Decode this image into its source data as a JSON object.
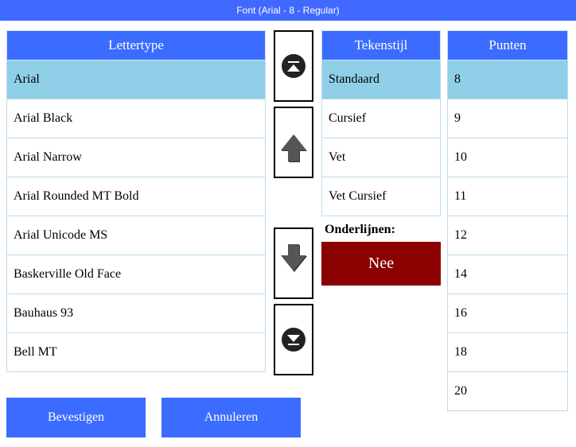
{
  "title": "Font (Arial - 8 - Regular)",
  "headers": {
    "font": "Lettertype",
    "style": "Tekenstijl",
    "size": "Punten"
  },
  "fonts": [
    {
      "label": "Arial",
      "selected": true
    },
    {
      "label": "Arial Black",
      "selected": false
    },
    {
      "label": "Arial Narrow",
      "selected": false
    },
    {
      "label": "Arial Rounded MT Bold",
      "selected": false
    },
    {
      "label": "Arial Unicode MS",
      "selected": false
    },
    {
      "label": "Baskerville Old Face",
      "selected": false
    },
    {
      "label": "Bauhaus 93",
      "selected": false
    },
    {
      "label": "Bell MT",
      "selected": false
    }
  ],
  "styles": [
    {
      "label": "Standaard",
      "selected": true
    },
    {
      "label": "Cursief",
      "selected": false
    },
    {
      "label": "Vet",
      "selected": false
    },
    {
      "label": "Vet Cursief",
      "selected": false
    }
  ],
  "sizes": [
    {
      "label": "8",
      "selected": true
    },
    {
      "label": "9",
      "selected": false
    },
    {
      "label": "10",
      "selected": false
    },
    {
      "label": "11",
      "selected": false
    },
    {
      "label": "12",
      "selected": false
    },
    {
      "label": "14",
      "selected": false
    },
    {
      "label": "16",
      "selected": false
    },
    {
      "label": "18",
      "selected": false
    },
    {
      "label": "20",
      "selected": false
    }
  ],
  "underline": {
    "label": "Onderlijnen:",
    "value": "Nee"
  },
  "buttons": {
    "confirm": "Bevestigen",
    "cancel": "Annuleren"
  }
}
